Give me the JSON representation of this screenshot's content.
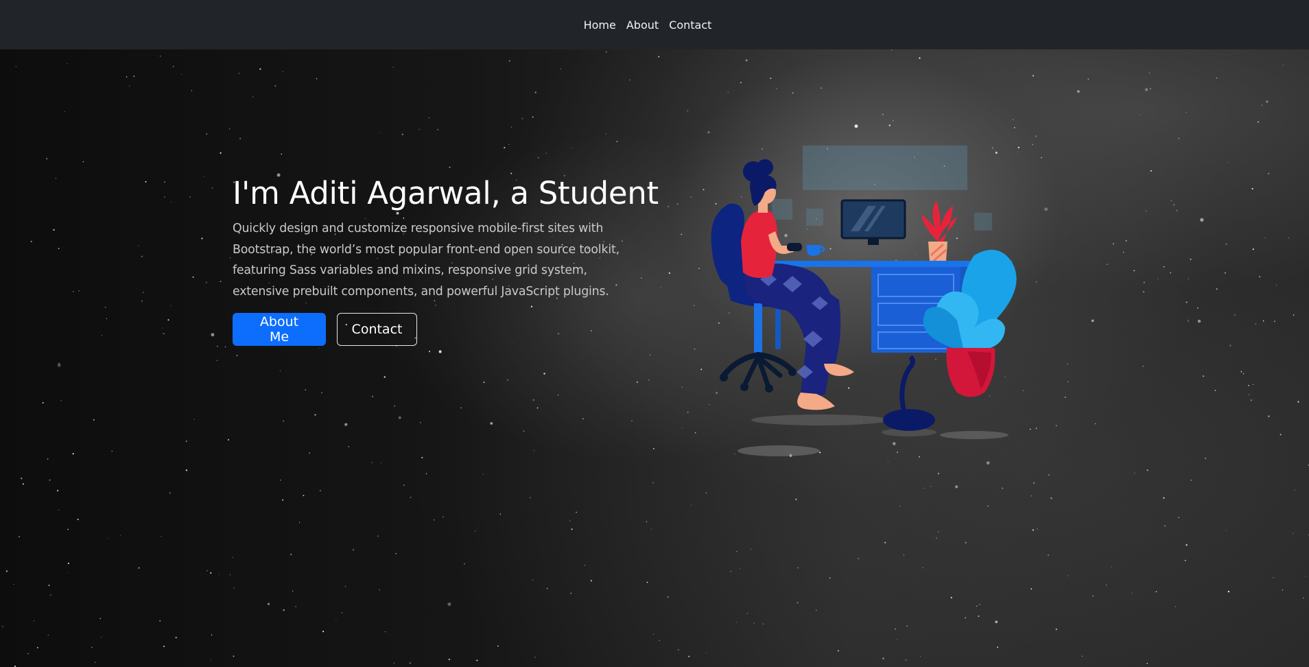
{
  "navbar": {
    "links": [
      {
        "label": "Home"
      },
      {
        "label": "About"
      },
      {
        "label": "Contact"
      }
    ]
  },
  "hero": {
    "title": "I'm Aditi Agarwal, a Student",
    "description": "Quickly design and customize responsive mobile-first sites with Bootstrap, the world’s most popular front-end open source toolkit, featuring Sass variables and mixins, responsive grid system, extensive prebuilt components, and powerful JavaScript plugins.",
    "buttons": {
      "primary_label": "About Me",
      "secondary_label": "Contact"
    }
  },
  "colors": {
    "navbar_bg": "#212529",
    "primary": "#0d6efd",
    "accent_red": "#e5243b",
    "plant_blue": "#1aa3e8"
  }
}
